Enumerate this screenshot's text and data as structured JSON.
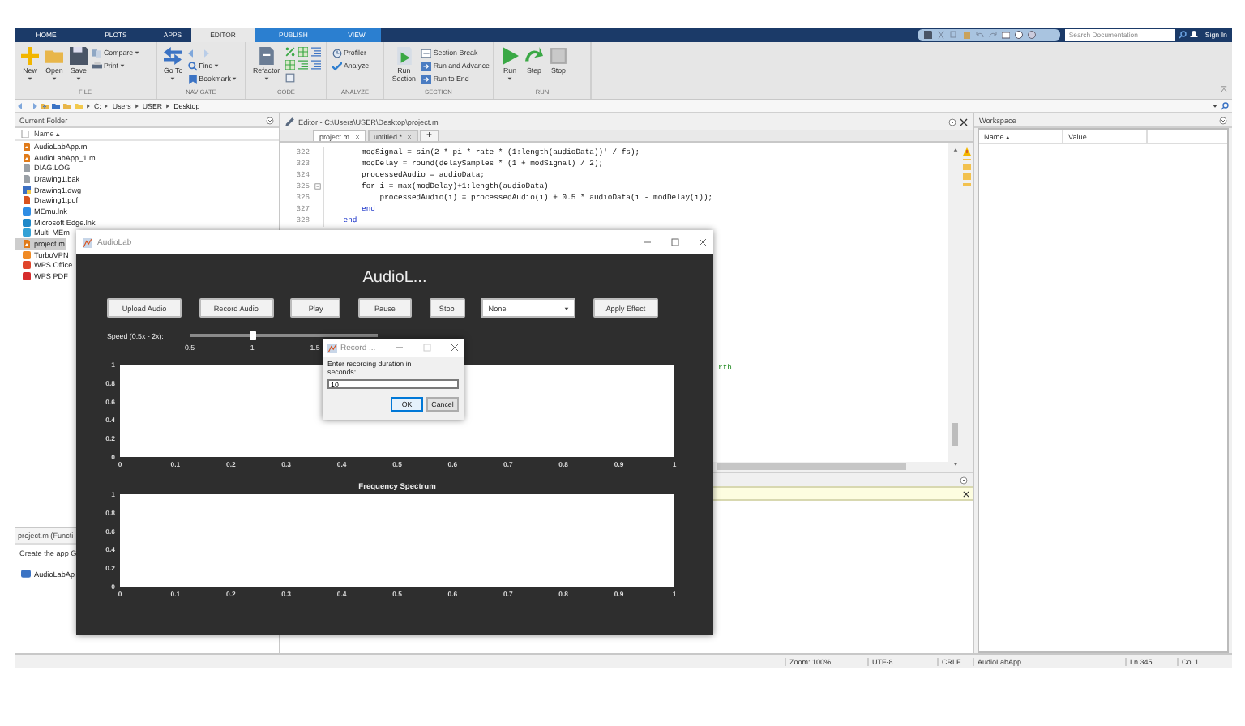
{
  "tabs": [
    {
      "label": "HOME",
      "selected": false,
      "kind": "main"
    },
    {
      "label": "PLOTS",
      "selected": false,
      "kind": "main"
    },
    {
      "label": "APPS",
      "selected": false,
      "kind": "main"
    },
    {
      "label": "EDITOR",
      "selected": true,
      "kind": "contextual"
    },
    {
      "label": "PUBLISH",
      "selected": false,
      "kind": "contextual"
    },
    {
      "label": "VIEW",
      "selected": false,
      "kind": "contextual"
    }
  ],
  "search": {
    "placeholder": "Search Documentation"
  },
  "sign_in": "Sign In",
  "ribbon": [
    {
      "label": "FILE",
      "items": [
        {
          "label": "New",
          "kind": "large",
          "dropdown": true
        },
        {
          "label": "Open",
          "kind": "large",
          "dropdown": true
        },
        {
          "label": "Save",
          "kind": "large",
          "dropdown": true
        },
        {
          "label": "Compare",
          "kind": "small",
          "dropdown": true
        },
        {
          "label": "Print",
          "kind": "small",
          "dropdown": true
        }
      ]
    },
    {
      "label": "NAVIGATE",
      "items": [
        {
          "label": "Go To",
          "kind": "large",
          "dropdown": true
        },
        {
          "label": "Find",
          "kind": "small",
          "dropdown": true
        },
        {
          "label": "Bookmark",
          "kind": "small",
          "dropdown": true
        }
      ]
    },
    {
      "label": "CODE",
      "items": [
        {
          "label": "Refactor",
          "kind": "large",
          "dropdown": true
        }
      ]
    },
    {
      "label": "ANALYZE",
      "items": [
        {
          "label": "Profiler",
          "kind": "small",
          "dropdown": false
        },
        {
          "label": "Analyze",
          "kind": "small",
          "dropdown": false
        }
      ]
    },
    {
      "label": "SECTION",
      "items": [
        {
          "label": "Run Section",
          "kind": "large",
          "dropdown": false
        },
        {
          "label": "Section Break",
          "kind": "small",
          "dropdown": false
        },
        {
          "label": "Run and Advance",
          "kind": "small",
          "dropdown": false
        },
        {
          "label": "Run to End",
          "kind": "small",
          "dropdown": false
        }
      ]
    },
    {
      "label": "RUN",
      "items": [
        {
          "label": "Run",
          "kind": "large",
          "dropdown": true
        },
        {
          "label": "Step",
          "kind": "large",
          "dropdown": false
        },
        {
          "label": "Stop",
          "kind": "large",
          "dropdown": false
        }
      ]
    }
  ],
  "path": [
    "C:",
    "Users",
    "USER",
    "Desktop"
  ],
  "current_folder": {
    "title": "Current Folder",
    "column": "Name ▴",
    "files": [
      {
        "name": "AudioLabApp.m",
        "kind": "script",
        "color": "#e07b1a",
        "selected": false
      },
      {
        "name": "AudioLabApp_1.m",
        "kind": "script",
        "color": "#e07b1a",
        "selected": false
      },
      {
        "name": "DIAG.LOG",
        "kind": "text",
        "color": "#9aa0a6",
        "selected": false
      },
      {
        "name": "Drawing1.bak",
        "kind": "text",
        "color": "#9aa0a6",
        "selected": false
      },
      {
        "name": "Drawing1.dwg",
        "kind": "drawing",
        "color": "#3b6fc2",
        "selected": false
      },
      {
        "name": "Drawing1.pdf",
        "kind": "pdf",
        "color": "#d9531e",
        "selected": false
      },
      {
        "name": "MEmu.lnk",
        "kind": "shortcut",
        "color": "#2f8de4",
        "selected": false
      },
      {
        "name": "Microsoft Edge.lnk",
        "kind": "shortcut",
        "color": "#1e88c9",
        "selected": false
      },
      {
        "name": "Multi-MEm",
        "kind": "shortcut",
        "color": "#33a1d6",
        "selected": false
      },
      {
        "name": "project.m",
        "kind": "script",
        "color": "#e07b1a",
        "selected": true
      },
      {
        "name": "TurboVPN",
        "kind": "shortcut",
        "color": "#f08a24",
        "selected": false
      },
      {
        "name": "WPS Office",
        "kind": "shortcut",
        "color": "#e0452b",
        "selected": false
      },
      {
        "name": "WPS PDF",
        "kind": "shortcut",
        "color": "#d62b2b",
        "selected": false
      }
    ]
  },
  "details": {
    "title": "project.m  (Functi",
    "description": "Create the app G",
    "item": "AudioLabAp"
  },
  "editor": {
    "title": "Editor - C:\\Users\\USER\\Desktop\\project.m",
    "tabs": [
      {
        "label": "project.m",
        "selected": true
      },
      {
        "label": "untitled *",
        "selected": false
      }
    ],
    "new_tab": "+",
    "lines": [
      {
        "number": "322",
        "text": "        modSignal = sin(2 * pi * rate * (1:length(audioData))' / fs);",
        "kind": "code",
        "fold": false
      },
      {
        "number": "323",
        "text": "        modDelay = round(delaySamples * (1 + modSignal) / 2);",
        "kind": "code",
        "fold": false
      },
      {
        "number": "324",
        "text": "        processedAudio = audioData;",
        "kind": "code",
        "fold": false
      },
      {
        "number": "325",
        "text": "        for i = max(modDelay)+1:length(audioData)",
        "kind": "code",
        "fold": true
      },
      {
        "number": "326",
        "text": "            processedAudio(i) = processedAudio(i) + 0.5 * audioData(i - modDelay(i));",
        "kind": "code",
        "fold": false
      },
      {
        "number": "327",
        "text": "        end",
        "kind": "keyword",
        "fold": false
      },
      {
        "number": "328",
        "text": "    end",
        "kind": "keyword",
        "fold": false
      }
    ],
    "comment_fragment": "rth"
  },
  "workspace": {
    "title": "Workspace",
    "columns": [
      "Name ▴",
      "Value"
    ]
  },
  "status_bar": [
    "Zoom: 100%",
    "UTF-8",
    "CRLF",
    "AudioLabApp",
    "Ln  345",
    "Col  1"
  ],
  "audiolab": {
    "title": "AudioLab",
    "heading": "AudioL...",
    "buttons": [
      "Upload Audio",
      "Record Audio",
      "Play",
      "Pause",
      "Stop"
    ],
    "effect": {
      "value": "None"
    },
    "apply": "Apply Effect",
    "speed": {
      "label": "Speed (0.5x - 2x):",
      "level": 0.333,
      "ticks": [
        "0.5",
        "1",
        "1.5"
      ]
    },
    "charts": [
      {
        "chart_data": {
          "type": "line",
          "xlim": [
            0,
            1
          ],
          "ylim": [
            0,
            1
          ],
          "xticks": [
            0,
            0.1,
            0.2,
            0.3,
            0.4,
            0.5,
            0.6,
            0.7,
            0.8,
            0.9,
            1
          ],
          "yticks": [
            0,
            0.2,
            0.4,
            0.6,
            0.8,
            1
          ]
        }
      },
      {
        "chart_data": {
          "type": "line",
          "title": "Frequency Spectrum",
          "xlim": [
            0,
            1
          ],
          "ylim": [
            0,
            1
          ],
          "xticks": [
            0,
            0.1,
            0.2,
            0.3,
            0.4,
            0.5,
            0.6,
            0.7,
            0.8,
            0.9,
            1
          ],
          "yticks": [
            0,
            0.2,
            0.4,
            0.6,
            0.8,
            1
          ]
        }
      }
    ]
  },
  "dialog": {
    "title": "Record ...",
    "prompt": "Enter recording duration in seconds:",
    "value": "10",
    "buttons": [
      {
        "label": "OK",
        "selected": true
      },
      {
        "label": "Cancel",
        "selected": false
      }
    ]
  }
}
